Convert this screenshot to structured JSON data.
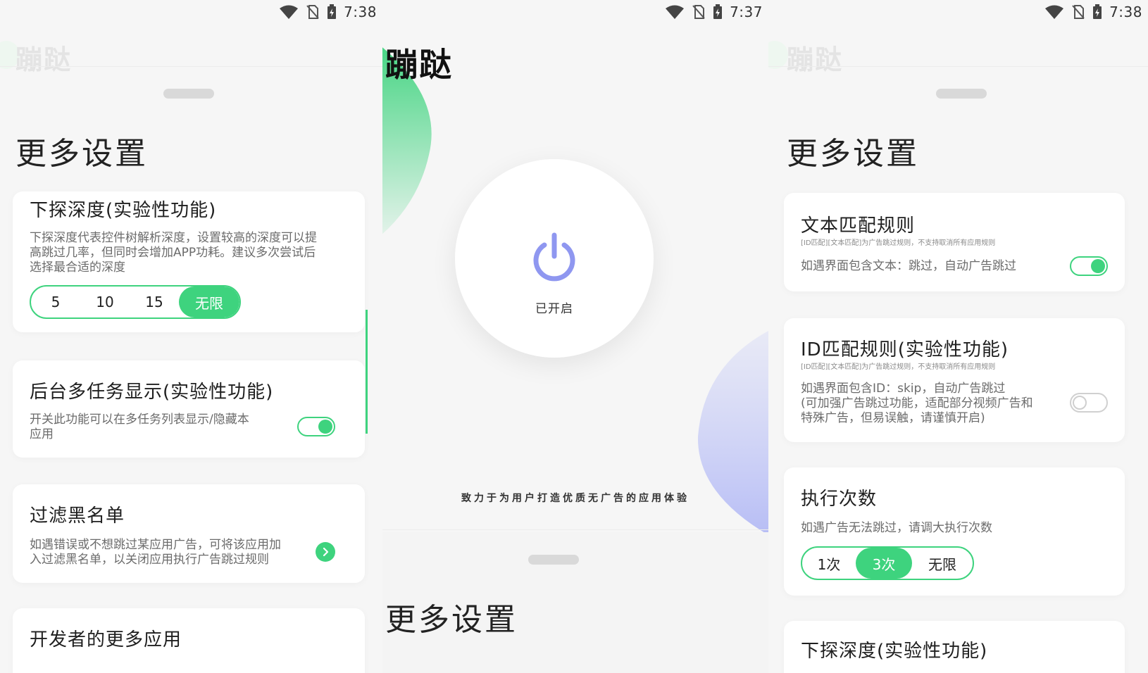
{
  "app_name": "蹦跶",
  "sheet_title": "更多设置",
  "status": {
    "s1_time": "7:38",
    "s2_time": "7:37",
    "s3_time": "7:38"
  },
  "screen1": {
    "depth": {
      "title": "下探深度(实验性功能)",
      "desc": [
        "下探深度代表控件树解析深度，设置较高的深度可以提",
        "高跳过几率，但同时会增加APP功耗。建议多次尝试后",
        "选择最合适的深度"
      ],
      "options": [
        "5",
        "10",
        "15",
        "无限"
      ],
      "selected": "无限"
    },
    "multitask": {
      "title": "后台多任务显示(实验性功能)",
      "desc": [
        "开关此功能可以在多任务列表显示/隐藏本",
        "应用"
      ],
      "enabled": true
    },
    "blacklist": {
      "title": "过滤黑名单",
      "desc": [
        "如遇错误或不想跳过某应用广告，可将该应用加",
        "入过滤黑名单，以关闭应用执行广告跳过规则"
      ]
    },
    "more_apps": {
      "title": "开发者的更多应用"
    }
  },
  "screen2": {
    "power_status": "已开启",
    "slogan": "致力于为用户打造优质无广告的应用体验"
  },
  "screen3": {
    "text_rule": {
      "title": "文本匹配规则",
      "sub": "[ID匹配][文本匹配]为广告跳过规则，不支持取消所有应用规则",
      "desc": "如遇界面包含文本：跳过，自动广告跳过",
      "enabled": true
    },
    "id_rule": {
      "title": "ID匹配规则(实验性功能)",
      "sub": "[ID匹配][文本匹配]为广告跳过规则，不支持取消所有应用规则",
      "desc": [
        "如遇界面包含ID：skip，自动广告跳过",
        "(可加强广告跳过功能，适配部分视频广告和",
        "特殊广告，但易误触，请谨慎开启)"
      ],
      "enabled": false
    },
    "exec_count": {
      "title": "执行次数",
      "desc": "如遇广告无法跳过，请调大执行次数",
      "options": [
        "1次",
        "3次",
        "无限"
      ],
      "selected": "3次"
    },
    "depth_title_partial": "下探深度(实验性功能)"
  },
  "colors": {
    "accent": "#3ed37e",
    "power_icon": "#8f97f0",
    "background": "#f6f6f6"
  }
}
